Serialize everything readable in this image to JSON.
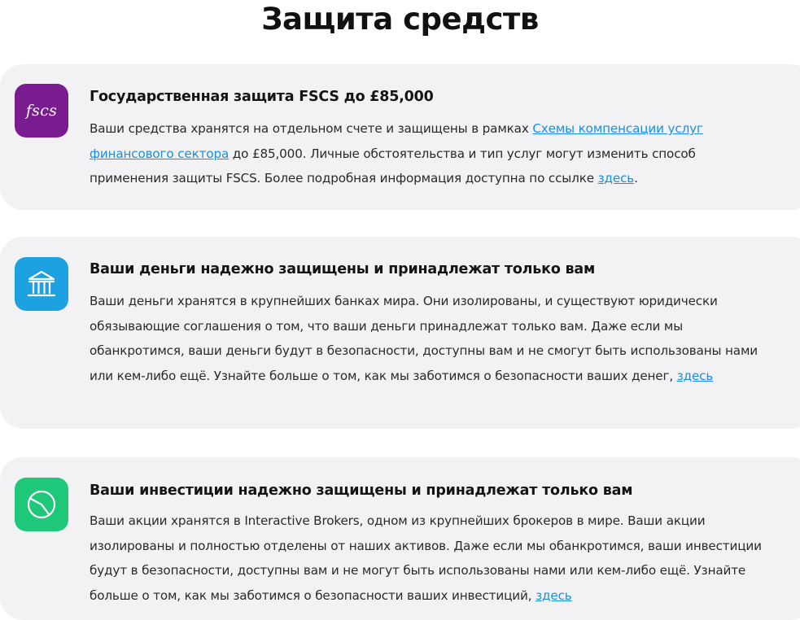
{
  "page": {
    "title": "Защита средств"
  },
  "cards": [
    {
      "icon": "fscs-logo-icon",
      "icon_text": "fscs",
      "icon_color": "#7a1b8f",
      "title": "Государственная защита FSCS до £85,000",
      "body_before": "Ваши средства хранятся на отдельном счете и защищены в рамках ",
      "link1": "Схемы компенсации услуг финансового сектора",
      "body_middle": " до £85,000. Личные обстоятельства и тип услуг могут изменить способ применения защиты FSCS. Более подробная информация доступна по ссылке ",
      "link2": "здесь",
      "body_after": "."
    },
    {
      "icon": "bank-icon",
      "icon_color": "#1ea1e0",
      "title": "Ваши деньги надежно защищены и принадлежат только вам",
      "body_before": "Ваши деньги хранятся в крупнейших банках мира. Они изолированы, и существуют юридически обязывающие соглашения о том, что ваши деньги принадлежат только вам. Даже если мы обанкротимся, ваши деньги будут в безопасности, доступны вам и не смогут быть использованы нами или кем-либо ещё. Узнайте больше о том, как мы заботимся о безопасности ваших денег, ",
      "link": "здесь"
    },
    {
      "icon": "pie-chart-icon",
      "icon_color": "#1fc77b",
      "title": "Ваши инвестиции надежно защищены и принадлежат только вам",
      "body_before": "Ваши акции хранятся в Interactive Brokers, одном из крупнейших брокеров в мире. Ваши акции изолированы и полностью отделены от наших активов. Даже если мы обанкротимся, ваши инвестиции будут в безопасности, доступны вам и не могут быть использованы нами или кем-либо ещё. Узнайте больше о том, как мы заботимся о безопасности ваших инвестиций, ",
      "link": "здесь"
    }
  ],
  "colors": {
    "card_bg": "#f2f2f4",
    "link": "#1a8fe0",
    "text": "#2a2a2a"
  }
}
